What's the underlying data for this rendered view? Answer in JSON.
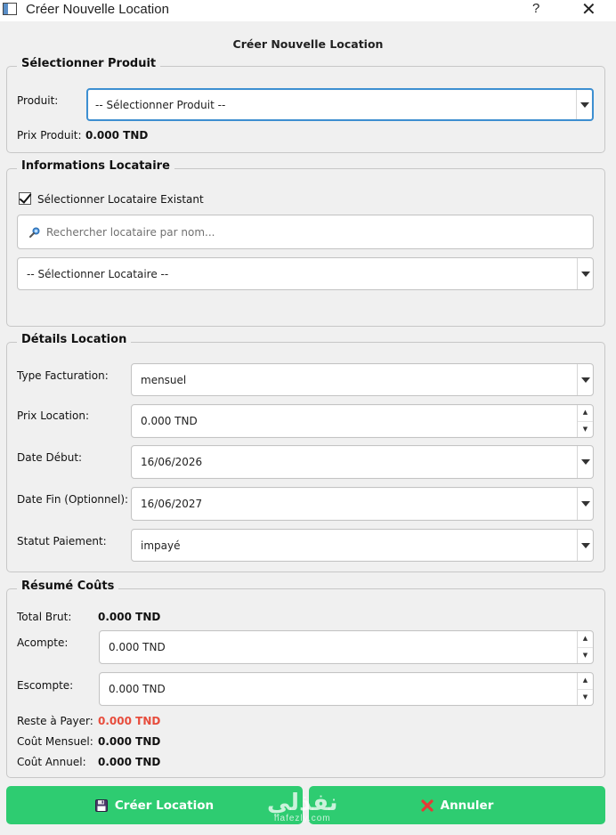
{
  "window": {
    "title": "Créer Nouvelle Location",
    "help_label": "?",
    "close_label": "✕"
  },
  "header": {
    "title": "Créer Nouvelle Location"
  },
  "produit_group": {
    "title": "Sélectionner Produit",
    "produit_label": "Produit:",
    "produit_value": "-- Sélectionner Produit --",
    "prix_label": "Prix Produit:",
    "prix_value": "0.000 TND"
  },
  "locataire_group": {
    "title": "Informations Locataire",
    "existing_checkbox_label": "Sélectionner Locataire Existant",
    "existing_checked": true,
    "search_placeholder": "Rechercher locataire par nom...",
    "locataire_value": "-- Sélectionner Locataire --"
  },
  "details_group": {
    "title": "Détails Location",
    "type_label": "Type Facturation:",
    "type_value": "mensuel",
    "prix_label": "Prix Location:",
    "prix_value": "0.000 TND",
    "date_debut_label": "Date Début:",
    "date_debut_value": "16/06/2026",
    "date_fin_label": "Date Fin (Optionnel):",
    "date_fin_value": "16/06/2027",
    "statut_label": "Statut Paiement:",
    "statut_value": "impayé"
  },
  "resume_group": {
    "title": "Résumé Coûts",
    "total_label": "Total Brut:",
    "total_value": "0.000 TND",
    "acompte_label": "Acompte:",
    "acompte_value": "0.000 TND",
    "escompte_label": "Escompte:",
    "escompte_value": "0.000 TND",
    "reste_label": "Reste à Payer:",
    "reste_value": "0.000 TND",
    "mensuel_label": "Coût Mensuel:",
    "mensuel_value": "0.000 TND",
    "annuel_label": "Coût Annuel:",
    "annuel_value": "0.000 TND"
  },
  "buttons": {
    "create_label": "Créer Location",
    "cancel_label": "Annuler"
  },
  "watermark": {
    "arabic": "نفذلي",
    "latin": "nafezly.com"
  },
  "colors": {
    "accent_green": "#2ecc71",
    "warning_red": "#e74c3c",
    "focus_blue": "#3d8fd1"
  },
  "icons": {
    "app": "window-app-icon",
    "search": "search-icon",
    "save": "floppy-disk-icon",
    "cancel": "cross-icon",
    "dropdown": "chevron-down-icon"
  }
}
